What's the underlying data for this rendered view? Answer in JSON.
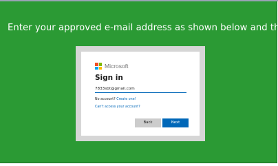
{
  "page": {
    "instruction": "Enter your approved e-mail address as shown below and then sign in:",
    "background_color": "#2b9a34"
  },
  "signin": {
    "brand_name": "Microsoft",
    "brand_logo_colors": [
      "#f25022",
      "#7fba00",
      "#00a4ef",
      "#ffb900"
    ],
    "title": "Sign in",
    "email_value": "7833sbt@gmail.com",
    "no_account_text": "No account?",
    "create_link": "Create one!",
    "cant_access_link": "Can't access your account?",
    "back_label": "Back",
    "next_label": "Next",
    "accent_color": "#0067b8"
  }
}
